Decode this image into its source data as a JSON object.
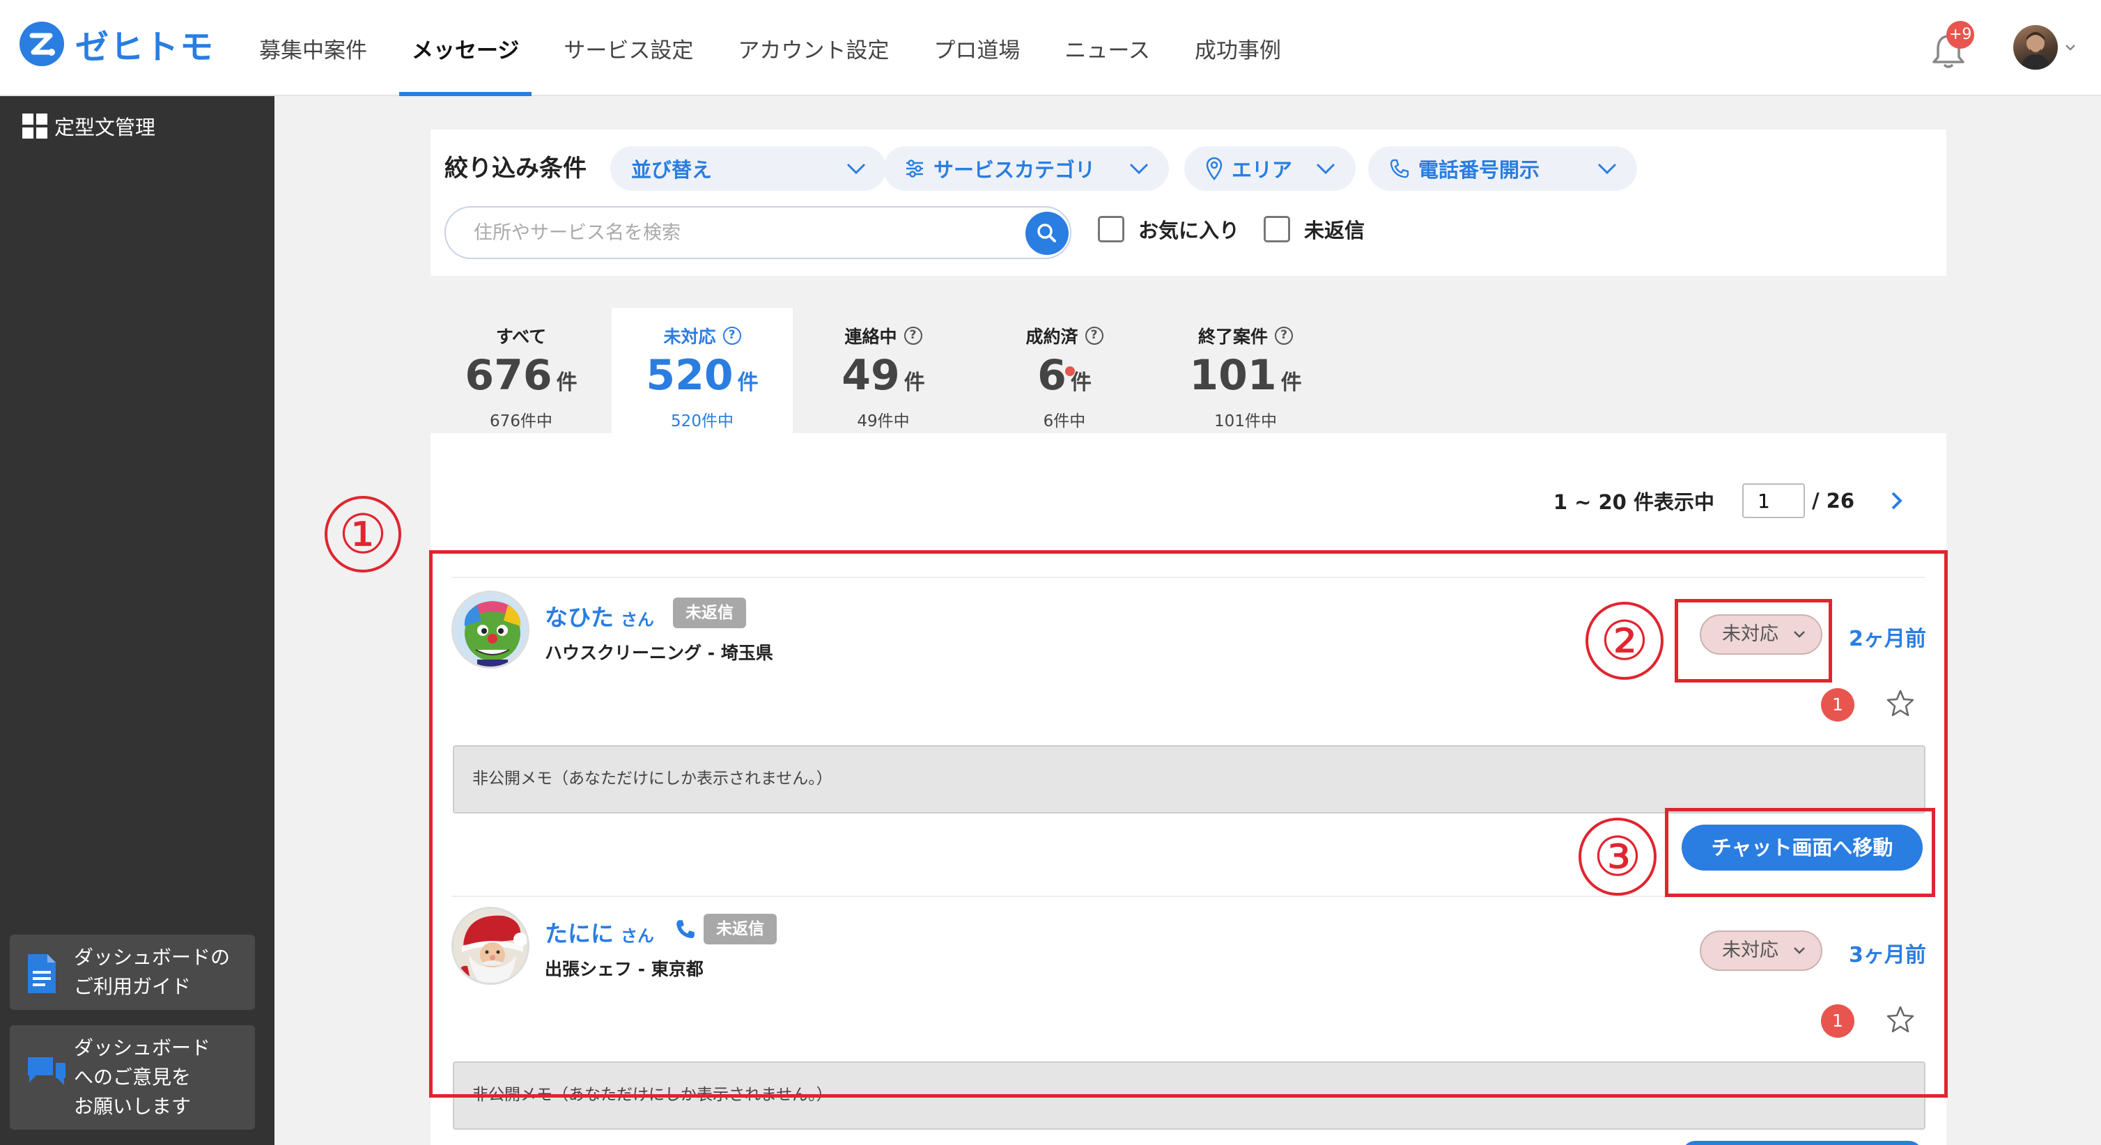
{
  "header": {
    "logo_text": "ゼヒトモ",
    "nav": [
      {
        "label": "募集中案件",
        "active": false
      },
      {
        "label": "メッセージ",
        "active": true
      },
      {
        "label": "サービス設定",
        "active": false
      },
      {
        "label": "アカウント設定",
        "active": false
      },
      {
        "label": "プロ道場",
        "active": false
      },
      {
        "label": "ニュース",
        "active": false
      },
      {
        "label": "成功事例",
        "active": false
      }
    ],
    "notification_badge": "+9"
  },
  "sidebar": {
    "templates_label": "定型文管理",
    "guide": {
      "line1": "ダッシュボードの",
      "line2": "ご利用ガイド"
    },
    "feedback": {
      "line1": "ダッシュボード",
      "line2": "へのご意見を",
      "line3": "お願いします"
    }
  },
  "filter": {
    "title": "絞り込み条件",
    "sort_label": "並び替え",
    "category_label": "サービスカテゴリ",
    "area_label": "エリア",
    "phone_label": "電話番号開示",
    "search_placeholder": "住所やサービス名を検索",
    "favorite_label": "お気に入り",
    "unreplied_label": "未返信"
  },
  "tabs": [
    {
      "label": "すべて",
      "count": "676",
      "unit": "件",
      "sub": "676件中",
      "help": false,
      "active": false
    },
    {
      "label": "未対応",
      "count": "520",
      "unit": "件",
      "sub": "520件中",
      "help": true,
      "active": true
    },
    {
      "label": "連絡中",
      "count": "49",
      "unit": "件",
      "sub": "49件中",
      "help": true,
      "active": false
    },
    {
      "label": "成約済",
      "count": "6",
      "unit": "件",
      "sub": "6件中",
      "help": true,
      "active": false
    },
    {
      "label": "終了案件",
      "count": "101",
      "unit": "件",
      "sub": "101件中",
      "help": true,
      "active": false
    }
  ],
  "pager": {
    "range_text": "1 ~ 20 件表示中",
    "current_page": "1",
    "total_pages": "/ 26"
  },
  "items": [
    {
      "name": "なひた",
      "honorific": "さん",
      "badge": "未返信",
      "service": "ハウスクリーニング - 埼玉県",
      "status": "未対応",
      "ago": "2ヶ月前",
      "unread": "1",
      "memo": "非公開メモ（あなただけにしか表示されません。）",
      "chat_button": "チャット画面へ移動"
    },
    {
      "name": "たにに",
      "honorific": "さん",
      "badge": "未返信",
      "service": "出張シェフ - 東京都",
      "status": "未対応",
      "ago": "3ヶ月前",
      "unread": "1",
      "memo": "非公開メモ（あなただけにしか表示されません。）"
    }
  ],
  "annotations": {
    "one": "①",
    "two": "②",
    "three": "③"
  },
  "colors": {
    "accent": "#2a7de1",
    "annotation_red": "#e0252f",
    "badge_red": "#e8554f",
    "sidebar": "#333333"
  }
}
